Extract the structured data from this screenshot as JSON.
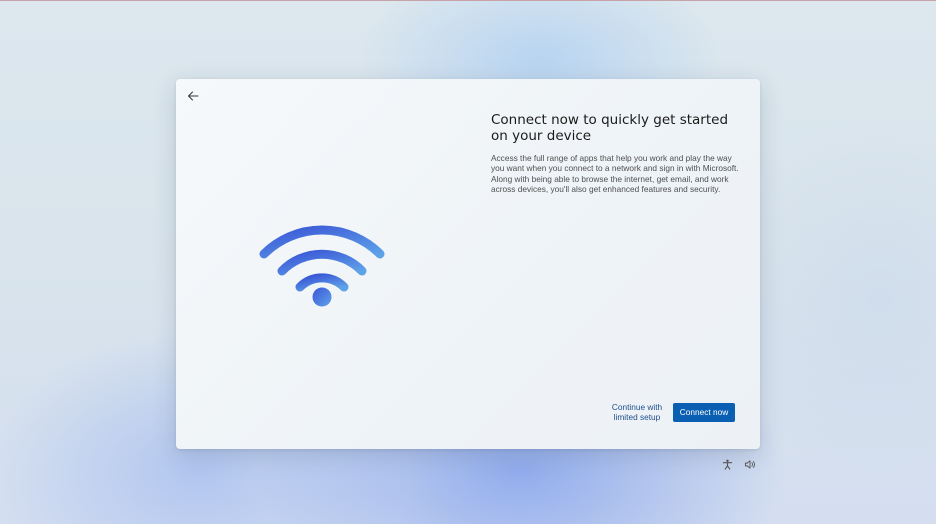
{
  "dialog": {
    "back_icon": "arrow-left-icon",
    "illustration_icon": "wifi-icon",
    "illustration_colors": {
      "start": "#3a56d6",
      "end": "#5ea2e8"
    },
    "title": "Connect now to quickly get started on your device",
    "description": "Access the full range of apps that help you work and play the way you want when you connect to a network and sign in with Microsoft. Along with being able to browse the internet, get email, and work across devices, you'll also get enhanced features and security.",
    "secondary_button": "Continue with limited setup",
    "primary_button": "Connect now",
    "accent_color": "#0a5fb3"
  },
  "taskbar": {
    "accessibility_icon": "accessibility-icon",
    "volume_icon": "volume-icon"
  }
}
